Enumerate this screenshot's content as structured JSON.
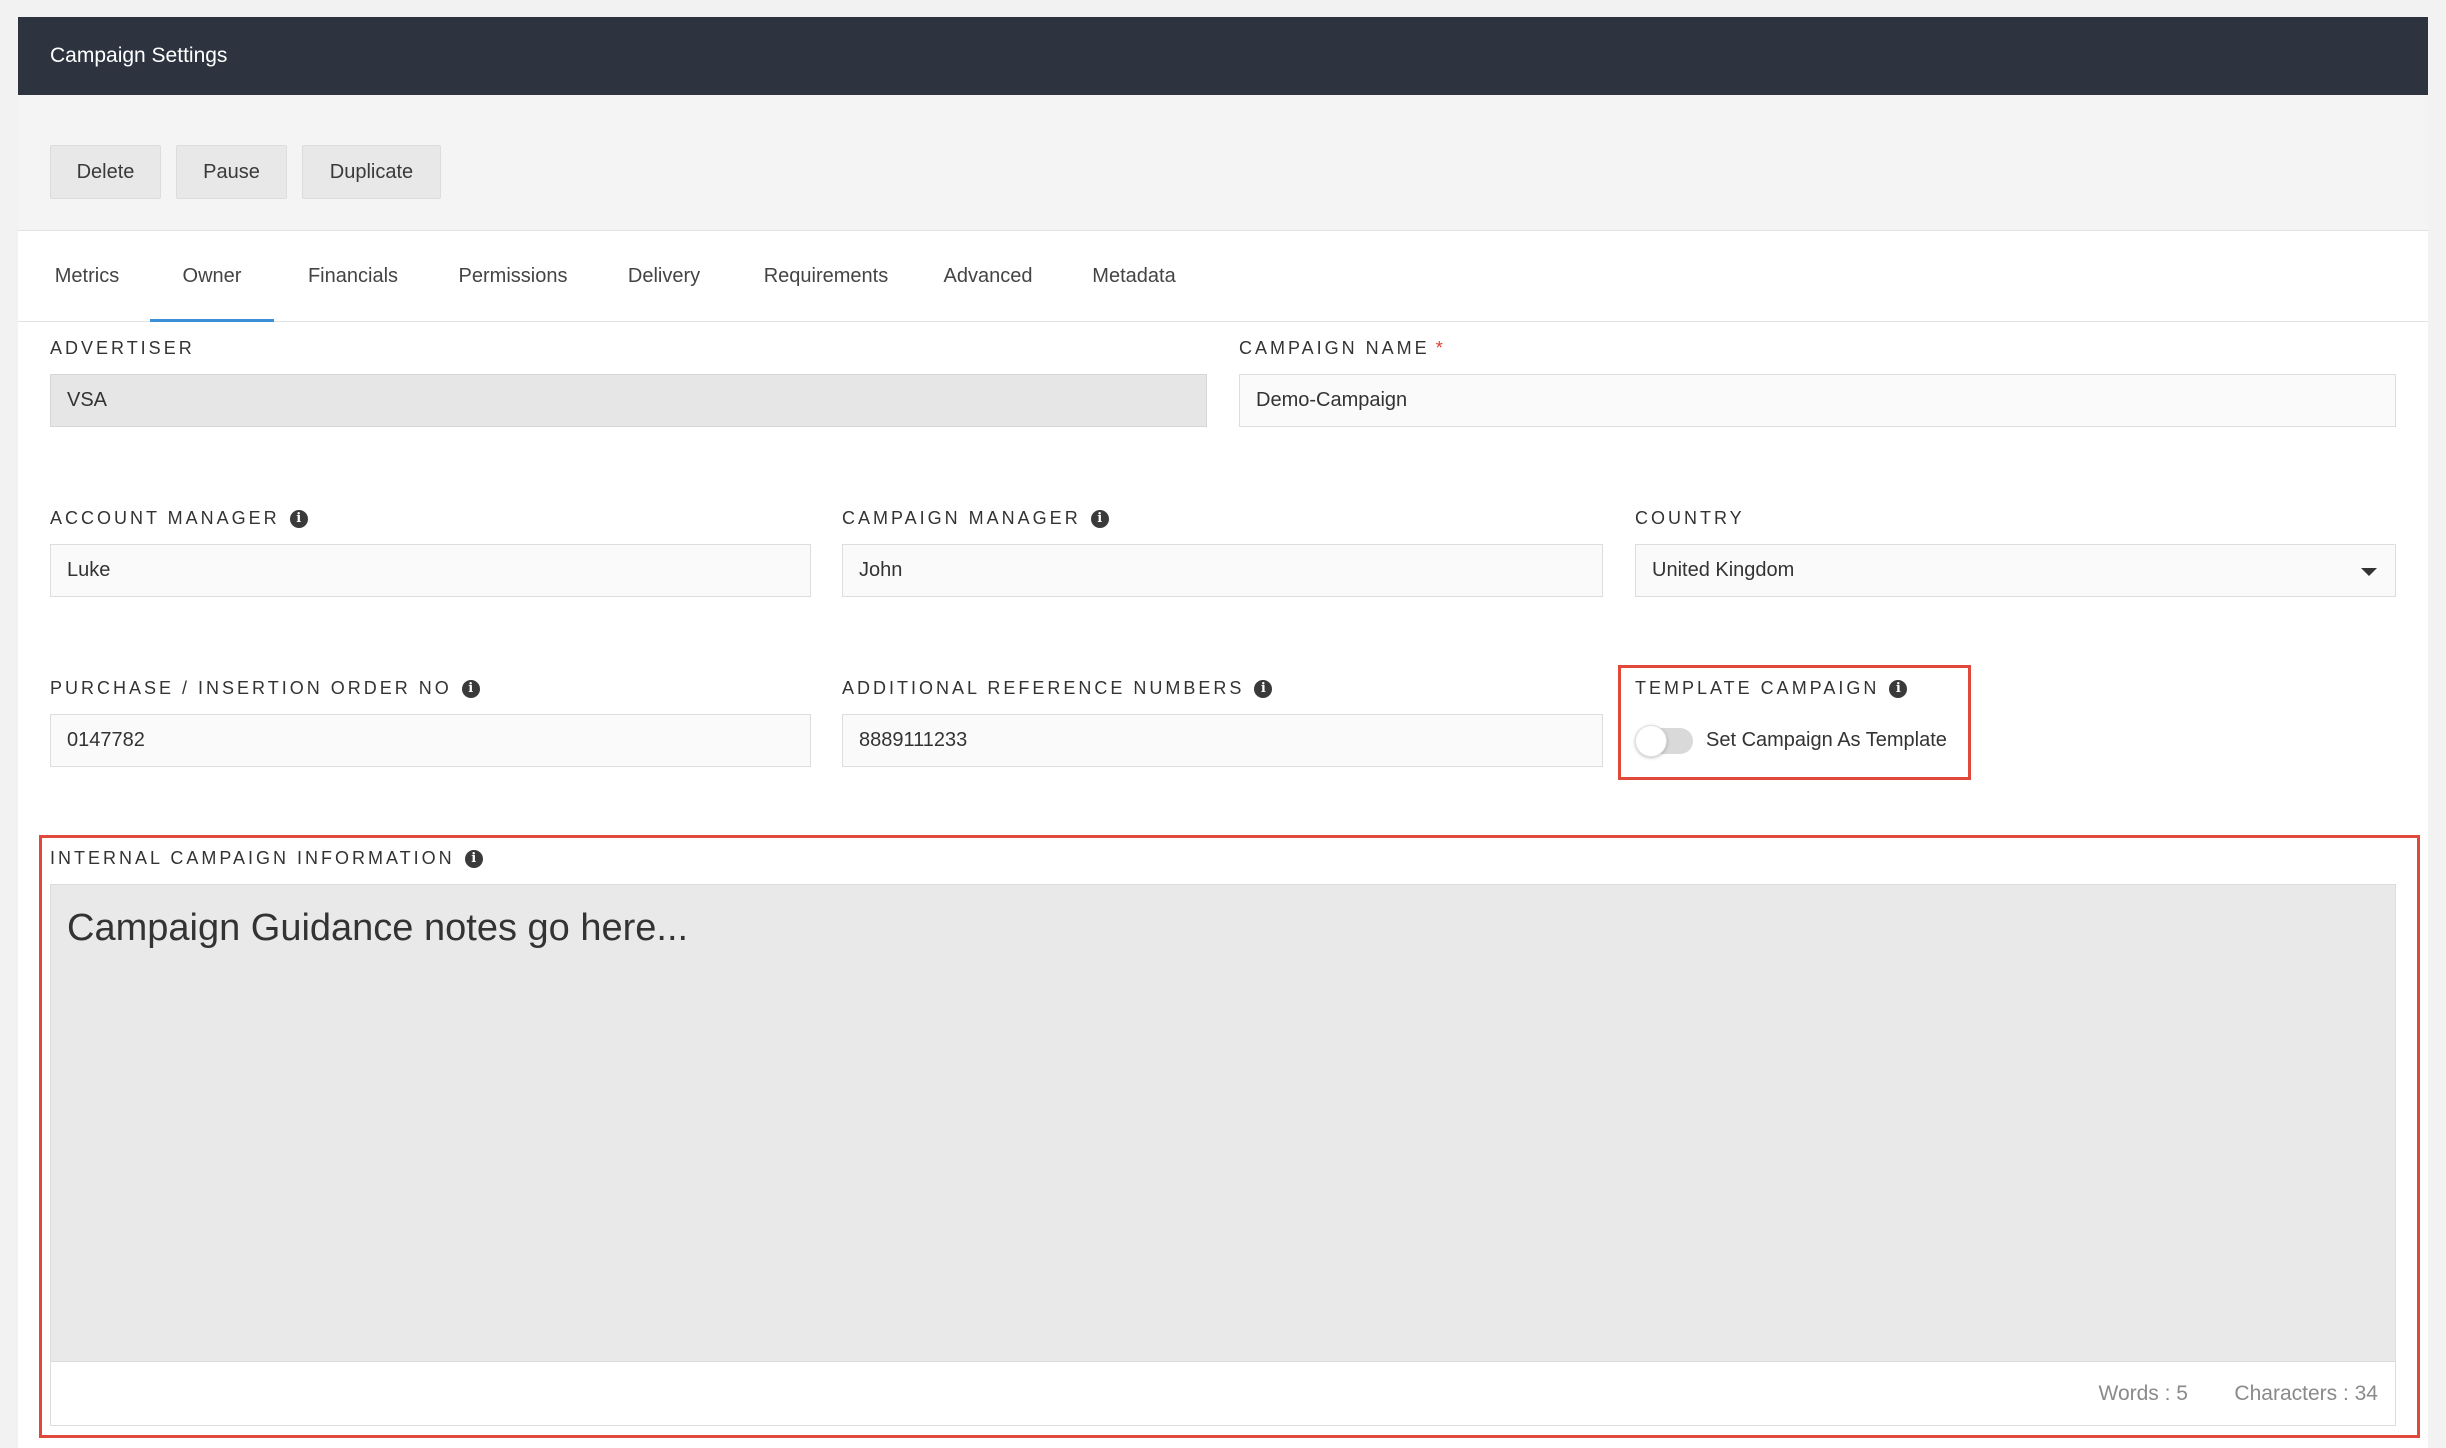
{
  "window": {
    "title": "Campaign Settings"
  },
  "toolbar": {
    "delete_label": "Delete",
    "pause_label": "Pause",
    "duplicate_label": "Duplicate"
  },
  "tabs": [
    {
      "label": "Metrics",
      "active": false
    },
    {
      "label": "Owner",
      "active": true
    },
    {
      "label": "Financials",
      "active": false
    },
    {
      "label": "Permissions",
      "active": false
    },
    {
      "label": "Delivery",
      "active": false
    },
    {
      "label": "Requirements",
      "active": false
    },
    {
      "label": "Advanced",
      "active": false
    },
    {
      "label": "Metadata",
      "active": false
    }
  ],
  "form": {
    "advertiser": {
      "label": "ADVERTISER",
      "value": "VSA",
      "disabled": true
    },
    "campaign_name": {
      "label": "CAMPAIGN NAME",
      "required_mark": "*",
      "value": "Demo-Campaign"
    },
    "account_manager": {
      "label": "ACCOUNT MANAGER",
      "value": "Luke"
    },
    "campaign_manager": {
      "label": "CAMPAIGN MANAGER",
      "value": "John"
    },
    "country": {
      "label": "COUNTRY",
      "selected": "United Kingdom"
    },
    "purchase_order": {
      "label": "PURCHASE / INSERTION ORDER NO",
      "value": "0147782"
    },
    "additional_refs": {
      "label": "ADDITIONAL REFERENCE NUMBERS",
      "value": "8889111233"
    },
    "template_campaign": {
      "label": "TEMPLATE CAMPAIGN",
      "toggle_label": "Set Campaign As Template",
      "enabled": false
    },
    "internal_info": {
      "label": "INTERNAL CAMPAIGN INFORMATION",
      "content": "Campaign Guidance notes go here...",
      "words": "Words : 5",
      "characters": "Characters : 34"
    }
  },
  "icons": {
    "info": "info-icon",
    "dropdown": "chevron-down-icon"
  },
  "colors": {
    "header_bg": "#2d3440",
    "tab_active": "#3b8fd6",
    "highlight": "#e0483a",
    "required": "#e03a2e"
  }
}
